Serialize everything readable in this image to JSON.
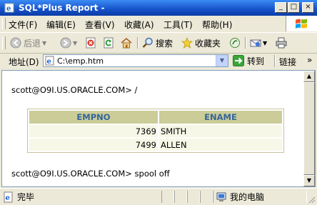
{
  "window": {
    "title": "SQL*Plus Report -",
    "controls": {
      "minimize": "_",
      "maximize": "□",
      "close": "×"
    }
  },
  "menu": {
    "items": [
      "文件(F)",
      "编辑(E)",
      "查看(V)",
      "收藏(A)",
      "工具(T)",
      "帮助(H)"
    ]
  },
  "toolbar": {
    "back_label": "后退",
    "search_label": "搜索",
    "favorites_label": "收藏夹",
    "icons": [
      "back-icon",
      "forward-icon",
      "stop-icon",
      "refresh-icon",
      "home-icon",
      "search-icon",
      "favorites-icon",
      "media-icon",
      "mail-icon",
      "print-icon"
    ]
  },
  "address": {
    "label": "地址(D)",
    "value": "C:\\emp.htm",
    "go_label": "转到",
    "links_label": "链接",
    "links_more": "»"
  },
  "document": {
    "prompt1": "scott@O9I.US.ORACLE.COM> /",
    "prompt2": "scott@O9I.US.ORACLE.COM> spool off",
    "table": {
      "columns": [
        "EMPNO",
        "ENAME"
      ],
      "rows": [
        [
          "7369",
          "SMITH"
        ],
        [
          "7499",
          "ALLEN"
        ]
      ]
    }
  },
  "status": {
    "done_label": "完毕",
    "zone_label": "我的电脑"
  },
  "colors": {
    "titlebar": "#0b3ca6",
    "table_header_bg": "#cccc99",
    "table_header_text": "#336699",
    "table_cell_bg": "#f7f7e7"
  }
}
